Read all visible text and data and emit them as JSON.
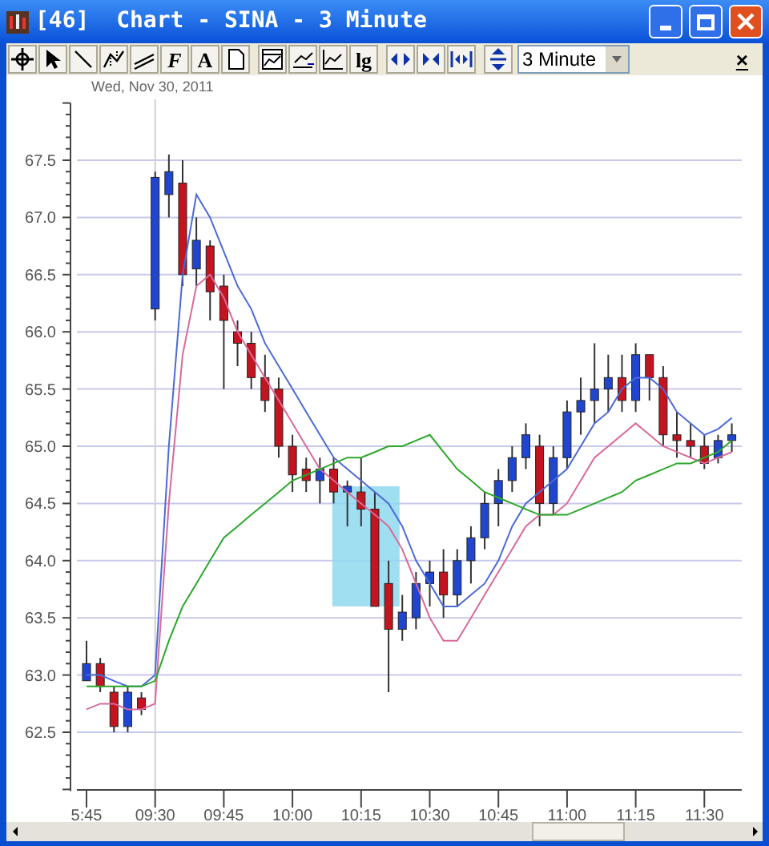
{
  "window": {
    "title": "[46]  Chart - SINA - 3 Minute"
  },
  "toolbar": {
    "font_button": "F",
    "text_button": "A",
    "log_button": "lg",
    "interval": "3 Minute",
    "close": "×"
  },
  "chart": {
    "date": "Wed, Nov 30, 2011",
    "chart_data": {
      "type": "candlestick",
      "grid": true,
      "categories": [
        "5:45",
        null,
        null,
        null,
        null,
        "09:30",
        null,
        null,
        null,
        null,
        "09:45",
        null,
        null,
        null,
        null,
        "10:00",
        null,
        null,
        null,
        null,
        "10:15",
        null,
        null,
        null,
        null,
        "10:30",
        null,
        null,
        null,
        null,
        "10:45",
        null,
        null,
        null,
        null,
        "11:00",
        null,
        null,
        null,
        null,
        "11:15",
        null,
        null,
        null,
        null,
        "11:30",
        null,
        null
      ],
      "yticks": [
        {
          "value": 62.5,
          "label": "62.5"
        },
        {
          "value": 63,
          "label": "63.0"
        },
        {
          "value": 63.5,
          "label": "63.5"
        },
        {
          "value": 64,
          "label": "64.0"
        },
        {
          "value": 64.5,
          "label": "64.5"
        },
        {
          "value": 65,
          "label": "65.0"
        },
        {
          "value": 65.5,
          "label": "65.5"
        },
        {
          "value": 66,
          "label": "66.0"
        },
        {
          "value": 66.5,
          "label": "66.5"
        },
        {
          "value": 67,
          "label": "67.0"
        },
        {
          "value": 67.5,
          "label": "67.5"
        }
      ],
      "ylim": [
        62,
        68
      ],
      "ohlc": [
        [
          62.95,
          63.3,
          62.95,
          63.1
        ],
        [
          63.1,
          63.15,
          62.85,
          62.9
        ],
        [
          62.85,
          62.9,
          62.5,
          62.55
        ],
        [
          62.55,
          62.9,
          62.5,
          62.85
        ],
        [
          62.8,
          62.85,
          62.65,
          62.7
        ],
        [
          66.2,
          67.4,
          66.1,
          67.35
        ],
        [
          67.2,
          67.55,
          67.0,
          67.4
        ],
        [
          67.3,
          67.5,
          66.4,
          66.5
        ],
        [
          66.55,
          67.0,
          66.4,
          66.8
        ],
        [
          66.75,
          66.8,
          66.1,
          66.35
        ],
        [
          66.4,
          66.5,
          65.5,
          66.1
        ],
        [
          66.0,
          66.1,
          65.7,
          65.9
        ],
        [
          65.9,
          66.0,
          65.5,
          65.6
        ],
        [
          65.6,
          65.8,
          65.3,
          65.4
        ],
        [
          65.5,
          65.6,
          64.9,
          65.0
        ],
        [
          65.0,
          65.1,
          64.6,
          64.75
        ],
        [
          64.8,
          64.9,
          64.6,
          64.7
        ],
        [
          64.7,
          64.9,
          64.5,
          64.8
        ],
        [
          64.8,
          64.9,
          64.5,
          64.6
        ],
        [
          64.6,
          64.7,
          64.3,
          64.65
        ],
        [
          64.6,
          64.9,
          64.3,
          64.45
        ],
        [
          64.45,
          64.6,
          63.6,
          63.6
        ],
        [
          63.8,
          64.0,
          62.85,
          63.4
        ],
        [
          63.4,
          63.7,
          63.3,
          63.55
        ],
        [
          63.5,
          63.9,
          63.4,
          63.8
        ],
        [
          63.8,
          64.0,
          63.6,
          63.9
        ],
        [
          63.9,
          64.1,
          63.5,
          63.7
        ],
        [
          63.7,
          64.1,
          63.6,
          64.0
        ],
        [
          64.0,
          64.3,
          63.8,
          64.2
        ],
        [
          64.2,
          64.6,
          64.1,
          64.5
        ],
        [
          64.5,
          64.8,
          64.3,
          64.7
        ],
        [
          64.7,
          65.0,
          64.6,
          64.9
        ],
        [
          64.9,
          65.2,
          64.8,
          65.1
        ],
        [
          65.0,
          65.1,
          64.3,
          64.5
        ],
        [
          64.5,
          65.0,
          64.4,
          64.9
        ],
        [
          64.9,
          65.4,
          64.8,
          65.3
        ],
        [
          65.3,
          65.6,
          65.1,
          65.4
        ],
        [
          65.4,
          65.9,
          65.2,
          65.5
        ],
        [
          65.5,
          65.8,
          65.3,
          65.6
        ],
        [
          65.6,
          65.8,
          65.3,
          65.4
        ],
        [
          65.4,
          65.9,
          65.3,
          65.8
        ],
        [
          65.8,
          65.8,
          65.4,
          65.6
        ],
        [
          65.6,
          65.7,
          65.0,
          65.1
        ],
        [
          65.1,
          65.3,
          64.9,
          65.05
        ],
        [
          65.05,
          65.2,
          64.9,
          65.0
        ],
        [
          65.0,
          65.1,
          64.8,
          64.85
        ],
        [
          64.9,
          65.1,
          64.85,
          65.05
        ],
        [
          65.05,
          65.2,
          64.95,
          65.1
        ]
      ],
      "series": [
        {
          "type": "line",
          "color": "#4a6ad8",
          "values": [
            63.0,
            63.0,
            62.95,
            62.9,
            62.9,
            63.0,
            65.0,
            66.5,
            67.2,
            67.0,
            66.7,
            66.4,
            66.2,
            65.9,
            65.7,
            65.5,
            65.3,
            65.1,
            64.9,
            64.8,
            64.7,
            64.6,
            64.5,
            64.3,
            64.0,
            63.8,
            63.6,
            63.6,
            63.7,
            63.8,
            64.0,
            64.3,
            64.5,
            64.6,
            64.7,
            64.8,
            65.0,
            65.2,
            65.3,
            65.5,
            65.6,
            65.6,
            65.5,
            65.3,
            65.2,
            65.1,
            65.15,
            65.25
          ]
        },
        {
          "type": "line",
          "color": "#d86a9a",
          "values": [
            62.7,
            62.75,
            62.75,
            62.7,
            62.7,
            62.75,
            64.5,
            65.8,
            66.4,
            66.5,
            66.3,
            66.0,
            65.8,
            65.6,
            65.4,
            65.2,
            65.0,
            64.8,
            64.7,
            64.6,
            64.5,
            64.4,
            64.3,
            64.1,
            63.8,
            63.5,
            63.3,
            63.3,
            63.5,
            63.7,
            63.9,
            64.1,
            64.3,
            64.4,
            64.4,
            64.5,
            64.7,
            64.9,
            65.0,
            65.1,
            65.2,
            65.1,
            65.0,
            64.95,
            64.9,
            64.85,
            64.9,
            64.95
          ]
        },
        {
          "type": "line",
          "color": "#2aa82a",
          "values": [
            62.9,
            62.9,
            62.9,
            62.9,
            62.9,
            62.95,
            63.3,
            63.6,
            63.8,
            64.0,
            64.2,
            64.3,
            64.4,
            64.5,
            64.6,
            64.7,
            64.75,
            64.8,
            64.85,
            64.9,
            64.9,
            64.95,
            65.0,
            65.0,
            65.05,
            65.1,
            64.95,
            64.8,
            64.7,
            64.6,
            64.55,
            64.5,
            64.45,
            64.4,
            64.4,
            64.4,
            64.45,
            64.5,
            64.55,
            64.6,
            64.7,
            64.75,
            64.8,
            64.85,
            64.85,
            64.9,
            64.95,
            65.05
          ]
        }
      ]
    }
  }
}
